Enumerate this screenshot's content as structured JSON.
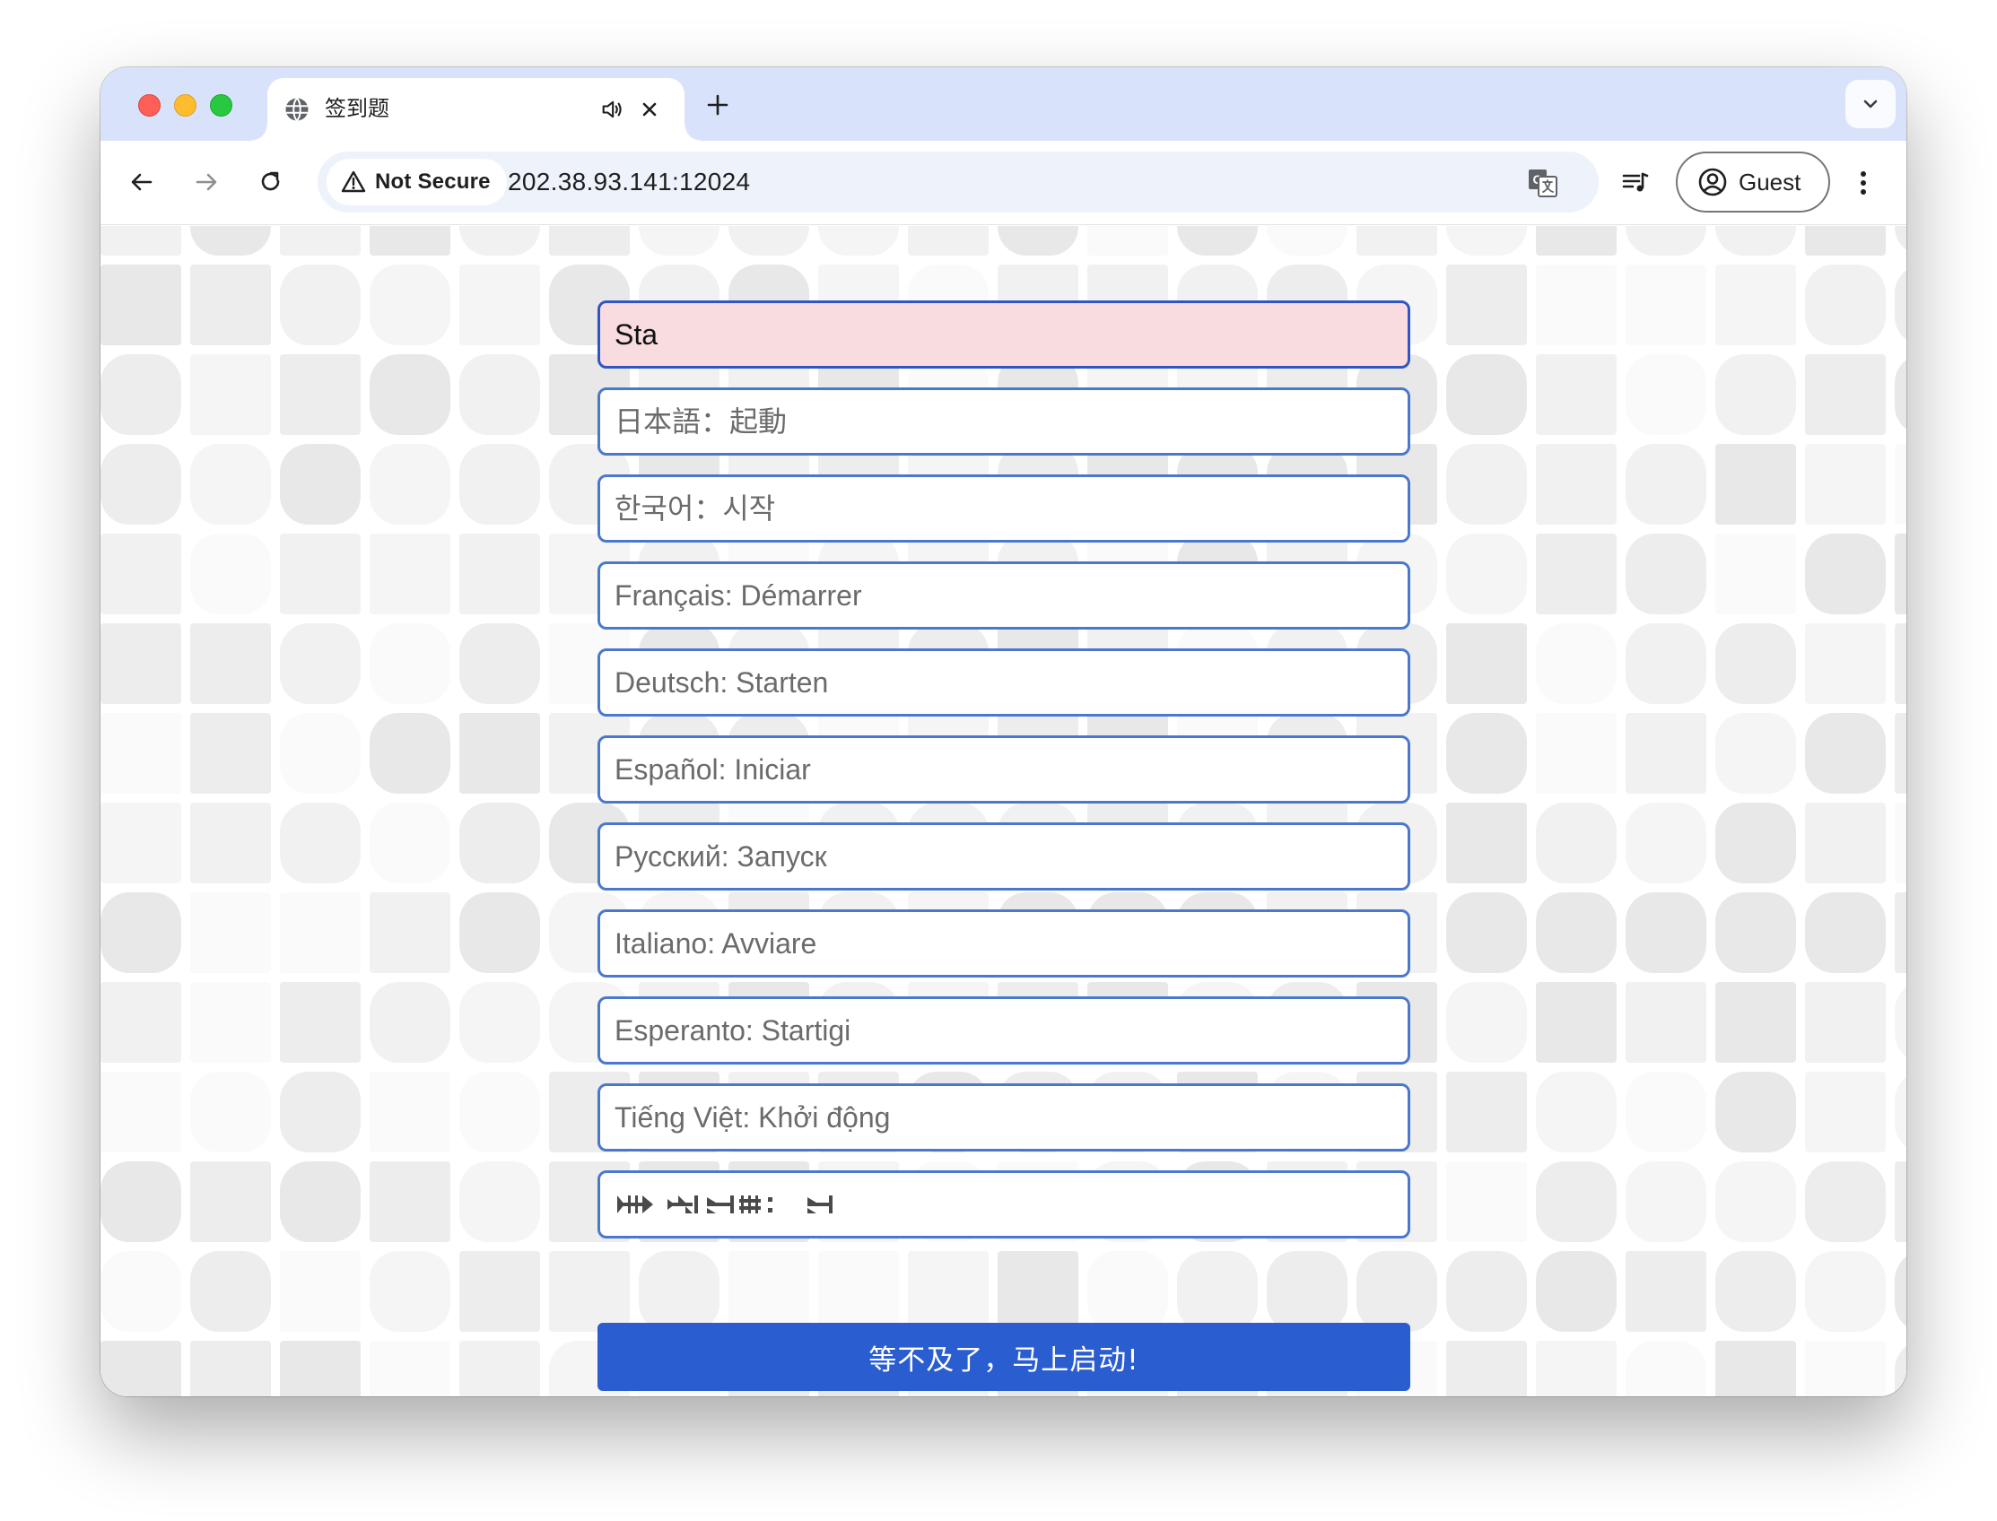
{
  "browser": {
    "tab": {
      "title": "签到题",
      "favicon": "globe-icon",
      "audio_icon": "speaker-icon",
      "close_icon": "close-icon"
    },
    "new_tab_icon": "plus-icon",
    "tab_search_icon": "chevron-down-icon",
    "nav": {
      "back_icon": "arrow-left-icon",
      "forward_icon": "arrow-right-icon",
      "reload_icon": "reload-icon"
    },
    "security_label": "Not Secure",
    "url": "202.38.93.141:12024",
    "translate_icon": "translate-icon",
    "media_icon": "media-control-icon",
    "profile_label": "Guest",
    "menu_icon": "kebab-menu-icon"
  },
  "form": {
    "inputs": [
      {
        "value": "Sta",
        "placeholder": ""
      },
      {
        "value": "",
        "placeholder": "日本語：起動"
      },
      {
        "value": "",
        "placeholder": "한국어：시작"
      },
      {
        "value": "",
        "placeholder": "Français: Démarrer"
      },
      {
        "value": "",
        "placeholder": "Deutsch: Starten"
      },
      {
        "value": "",
        "placeholder": "Español: Iniciar"
      },
      {
        "value": "",
        "placeholder": "Русский: Запуск"
      },
      {
        "value": "",
        "placeholder": "Italiano: Avviare"
      },
      {
        "value": "",
        "placeholder": "Esperanto: Startigi"
      },
      {
        "value": "",
        "placeholder": "Tiếng Việt: Khởi động"
      },
      {
        "value": "",
        "placeholder": "cuneiform-glyphs"
      }
    ],
    "submit_label": "等不及了，马上启动!"
  },
  "colors": {
    "accent": "#2a5dd0",
    "input_border": "#4a78cf",
    "active_input_bg": "#f8dcdf",
    "tab_strip": "#d8e3fb"
  }
}
